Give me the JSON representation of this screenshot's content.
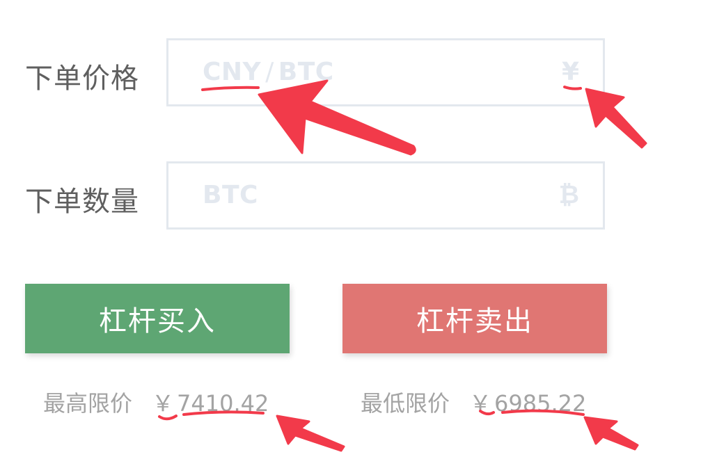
{
  "form": {
    "price": {
      "label": "下单价格",
      "placeholder_quote": "CNY",
      "placeholder_sep": "/",
      "placeholder_base": "BTC",
      "unit_symbol": "¥"
    },
    "amount": {
      "label": "下单数量",
      "placeholder": "BTC",
      "unit_symbol": "₿"
    }
  },
  "buttons": {
    "buy_label": "杠杆买入",
    "sell_label": "杠杆卖出"
  },
  "limits": {
    "max_label": "最高限价",
    "max_currency": "￥",
    "max_value": "7410.42",
    "min_label": "最低限价",
    "min_currency": "￥",
    "min_value": "6985.22"
  },
  "colors": {
    "buy": "#5ea673",
    "sell": "#e07673",
    "annotation": "#f23a4a"
  },
  "icons": {
    "price_unit": "yuan-icon",
    "amount_unit": "bitcoin-icon"
  }
}
